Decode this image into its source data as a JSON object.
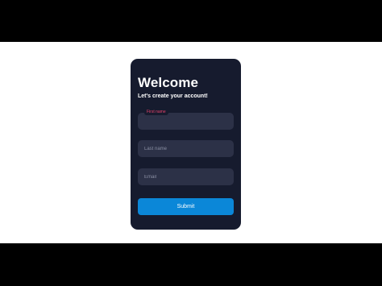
{
  "form": {
    "title": "Welcome",
    "subtitle": "Let's create your account!",
    "fields": [
      {
        "label": "First name",
        "value": "",
        "placeholder": ""
      },
      {
        "label": "",
        "value": "",
        "placeholder": "Last name"
      },
      {
        "label": "",
        "value": "",
        "placeholder": "Email"
      }
    ],
    "submit_label": "Submit"
  },
  "colors": {
    "letterbox": "#000000",
    "background": "#ffffff",
    "card": "#161b2e",
    "input": "#2c3147",
    "accent_label": "#e8436b",
    "button": "#0b87d8"
  }
}
